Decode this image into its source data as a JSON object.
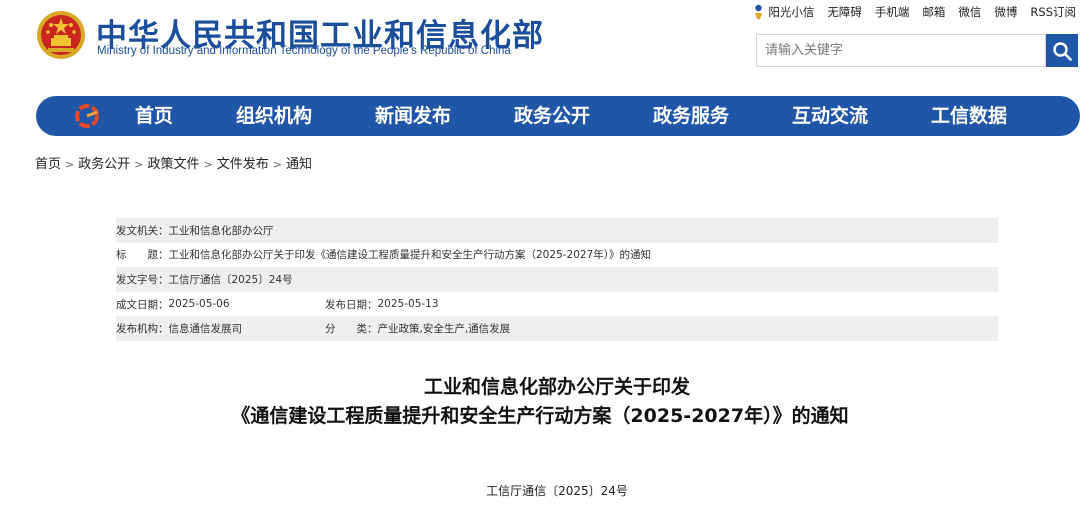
{
  "header": {
    "site_title": "中华人民共和国工业和信息化部",
    "site_subtitle": "Ministry of Industry and Information Technology of the People’s Republic of China",
    "top_links": [
      "阳光小信",
      "无障碍",
      "手机端",
      "邮箱",
      "微信",
      "微博",
      "RSS订阅"
    ],
    "search_placeholder": "请输入关键字",
    "icons": [
      "national-emblem-icon",
      "sun-icon",
      "search-icon"
    ]
  },
  "nav": {
    "items": [
      "首页",
      "组织机构",
      "新闻发布",
      "政务公开",
      "政务服务",
      "互动交流",
      "工信数据"
    ],
    "color": "#1f56a8"
  },
  "breadcrumb": [
    "首页",
    "政务公开",
    "政策文件",
    "文件发布",
    "通知"
  ],
  "meta": {
    "issuer_label": "发文机关：",
    "issuer": "工业和信息化部办公厅",
    "title_label": "标　　题：",
    "title": "工业和信息化部办公厅关于印发《通信建设工程质量提升和安全生产行动方案（2025-2027年）》的通知",
    "doc_no_label": "发文字号：",
    "doc_no": "工信厅通信〔2025〕24号",
    "written_date_label": "成文日期：",
    "written_date": "2025-05-06",
    "publish_date_label": "发布日期：",
    "publish_date": "2025-05-13",
    "agency_label": "发布机构：",
    "agency": "信息通信发展司",
    "category_label": "分　　类：",
    "category": "产业政策,安全生产,通信发展"
  },
  "article": {
    "title_line1": "工业和信息化部办公厅关于印发",
    "title_line2": "《通信建设工程质量提升和安全生产行动方案（2025-2027年）》的通知",
    "doc_number": "工信厅通信〔2025〕24号"
  }
}
